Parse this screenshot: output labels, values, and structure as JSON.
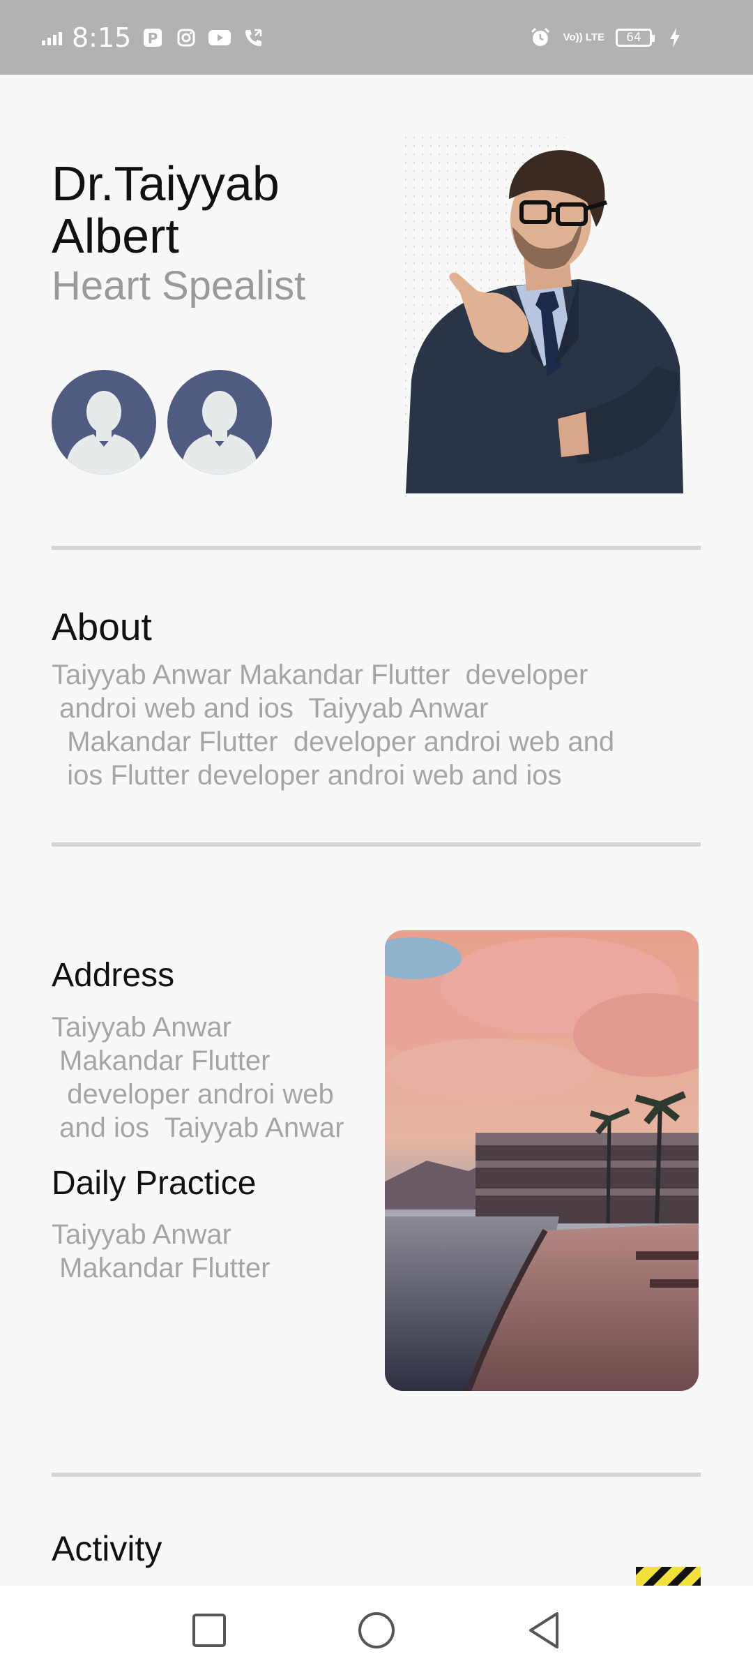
{
  "status_bar": {
    "time": "8:15",
    "battery": "64",
    "network": "Vo)) LTE",
    "icons": [
      "signal-icon",
      "parking-icon",
      "instagram-icon",
      "youtube-icon",
      "phone-call-icon",
      "alarm-icon",
      "charging-icon"
    ]
  },
  "profile": {
    "name_line1": "Dr.Taiyyab",
    "name_line2": "Albert",
    "specialty": "Heart Spealist"
  },
  "about": {
    "title": "About",
    "text": "Taiyyab Anwar Makandar Flutter  developer\n androi web and ios  Taiyyab Anwar\n  Makandar Flutter  developer androi web and\n  ios Flutter developer androi web and ios"
  },
  "address": {
    "title": "Address",
    "text": "Taiyyab Anwar\n Makandar Flutter\n  developer androi web\n and ios  Taiyyab Anwar"
  },
  "daily_practice": {
    "title": "Daily Practice",
    "text": "Taiyyab Anwar\n Makandar Flutter"
  },
  "activity": {
    "title": "Activity"
  },
  "colors": {
    "avatar_bg": "#4f5b80",
    "avatar_fg": "#e6eaea",
    "status_bar_bg": "#b2b2b2",
    "divider": "#d6d6d6",
    "muted_text": "#a5a5a5"
  }
}
